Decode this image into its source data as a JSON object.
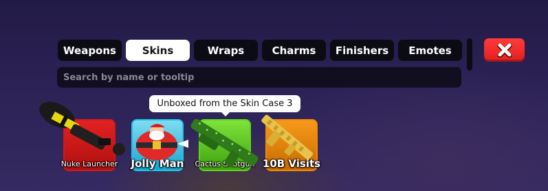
{
  "tabs": [
    {
      "label": "Weapons",
      "active": false
    },
    {
      "label": "Skins",
      "active": true
    },
    {
      "label": "Wraps",
      "active": false
    },
    {
      "label": "Charms",
      "active": false
    },
    {
      "label": "Finishers",
      "active": false
    },
    {
      "label": "Emotes",
      "active": false
    }
  ],
  "close_icon": "close-x-icon",
  "search": {
    "placeholder": "Search by name or tooltip",
    "value": ""
  },
  "tooltip": {
    "text": "Unboxed from the Skin Case 3"
  },
  "items": [
    {
      "name": "Nuke Launcher",
      "rarity_color": "#d11a1a",
      "icon": "nuke-launcher-icon"
    },
    {
      "name": "Jolly Man",
      "rarity_color": "#22c3e6",
      "icon": "jolly-man-icon"
    },
    {
      "name": "Cactus Shotgun",
      "rarity_color": "#5fd41e",
      "icon": "cactus-shotgun-icon"
    },
    {
      "name": "10B Visits",
      "rarity_color": "#f08a0a",
      "icon": "10b-visits-icon"
    }
  ],
  "colors": {
    "background": "#2c2255",
    "tab_bg": "#0b0b14",
    "tab_active_bg": "#ffffff",
    "close_button": "#ff3b3b"
  }
}
